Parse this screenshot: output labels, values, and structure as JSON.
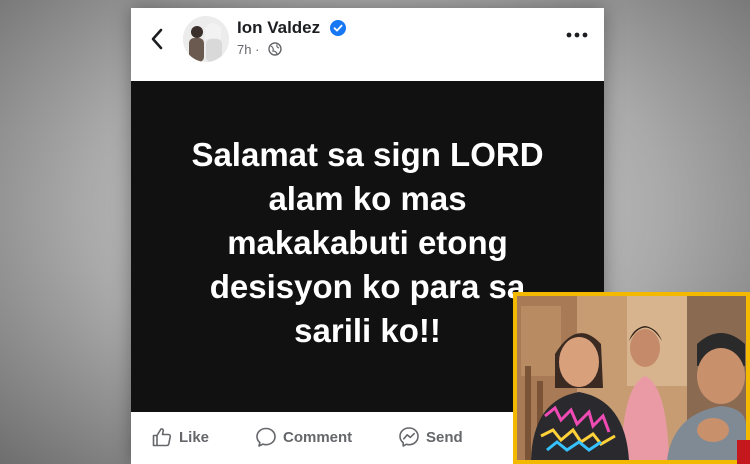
{
  "post": {
    "author": "Ion Valdez",
    "time": "7h",
    "separator": "·",
    "text_lines": [
      "Salamat sa sign LORD",
      "alam ko mas",
      "makakabuti etong",
      "desisyon ko para sa",
      "sarili ko!!"
    ]
  },
  "actions": {
    "like": "Like",
    "comment": "Comment",
    "send": "Send"
  },
  "colors": {
    "image_background": "#111111",
    "verified": "#1877f2",
    "inset_border": "#f2b900",
    "secondary_text": "#65676b"
  },
  "icons": [
    "back-icon",
    "verified-icon",
    "globe-icon",
    "more-icon",
    "like-icon",
    "comment-icon",
    "send-icon"
  ]
}
